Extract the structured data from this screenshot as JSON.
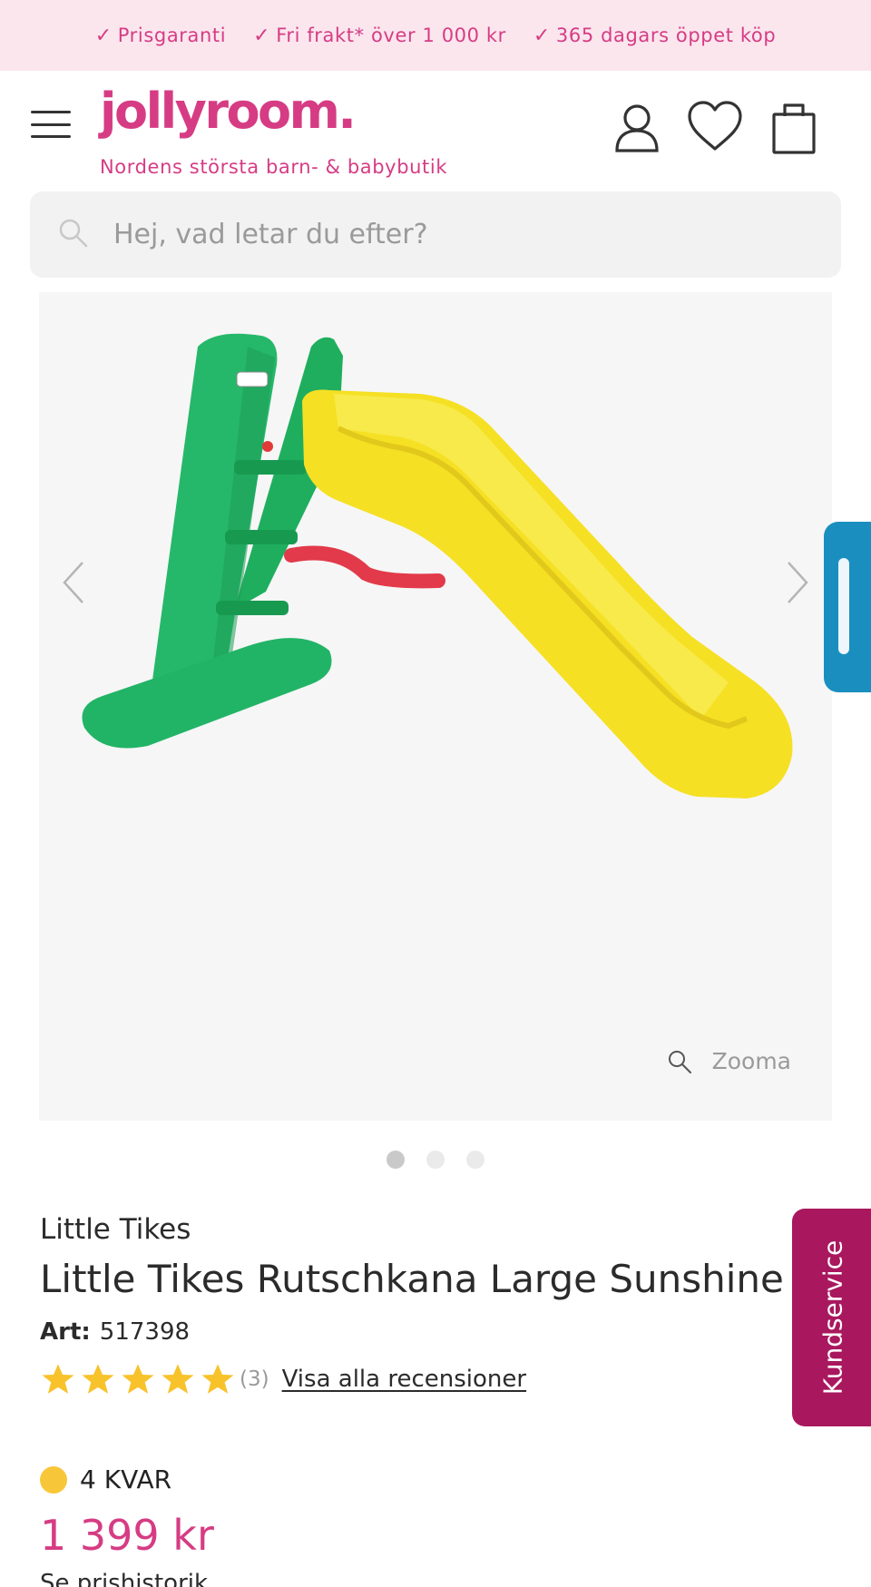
{
  "usp": [
    {
      "icon": "check-icon",
      "label": "Prisgaranti"
    },
    {
      "icon": "check-icon",
      "label": "Fri frakt* över 1 000 kr"
    },
    {
      "icon": "check-icon",
      "label": "365 dagars öppet köp"
    }
  ],
  "header": {
    "logo": "jollyroom.",
    "tagline": "Nordens största barn- & babybutik",
    "icons": [
      "menu-icon",
      "account-icon",
      "wishlist-heart-icon",
      "shopping-bag-icon"
    ]
  },
  "search": {
    "placeholder": "Hej, vad letar du efter?"
  },
  "gallery": {
    "zoom_label": "Zooma",
    "slide_count": 3,
    "active_slide": 1
  },
  "product": {
    "brand": "Little Tikes",
    "title": "Little Tikes Rutschkana Large Sunshine",
    "art_label": "Art:",
    "art_number": "517398",
    "rating": 5,
    "review_count": "(3)",
    "review_link": "Visa alla recensioner",
    "stock": "4 KVAR",
    "price": "1 399 kr",
    "price_history": "Se prishistorik"
  },
  "widgets": {
    "customer_service": "Kundservice"
  },
  "colors": {
    "brand_pink": "#d63c84",
    "usp_bg": "#fbe6ee",
    "stock_yellow": "#f8c739",
    "side_tab_blue": "#1a8fbf",
    "kundservice_bg": "#a9185e"
  }
}
